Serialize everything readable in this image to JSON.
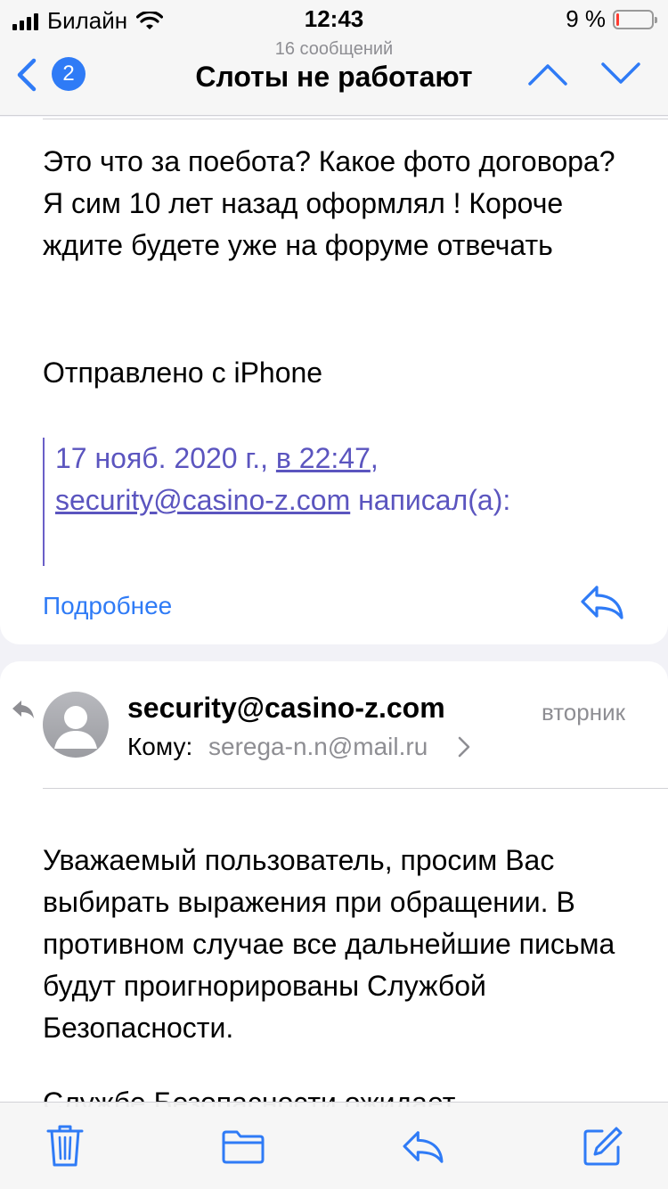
{
  "status": {
    "carrier": "Билайн",
    "time": "12:43",
    "battery": "9 %",
    "battery_level": 0.09
  },
  "nav": {
    "subtitle": "16 сообщений",
    "title": "Слоты не работают",
    "badge": "2"
  },
  "message1": {
    "body": "Это что за поебота? Какое фото договора? Я сим 10 лет назад оформлял ! Короче ждите будете уже на форуме отвечать",
    "signature": "Отправлено с iPhone",
    "quote_date": "17 нояб. 2020 г.,",
    "quote_time": "в 22:47",
    "quote_comma": ",",
    "quote_email": "security@casino-z.com",
    "quote_wrote": "написал(а):",
    "more_label": "Подробнее"
  },
  "message2": {
    "sender": "security@casino-z.com",
    "date": "вторник",
    "to_label": "Кому:",
    "to_address": "serega-n.n@mail.ru",
    "body": "Уважаемый пользователь, просим Вас выбирать выражения при обращении. В противном случае все дальнейшие письма будут проигнорированы Службой Безопасности.",
    "body_cut": "Службе Безопасности ожидает"
  },
  "icons": {
    "wifi": "wifi-icon",
    "back": "chevron-left-icon",
    "up": "chevron-up-icon",
    "down": "chevron-down-icon",
    "reply": "reply-icon",
    "trash": "trash-icon",
    "folder": "folder-icon",
    "compose": "compose-icon"
  },
  "colors": {
    "accent": "#2f7bf6",
    "quote": "#5b55bf",
    "battery_low": "#ff3b30"
  }
}
